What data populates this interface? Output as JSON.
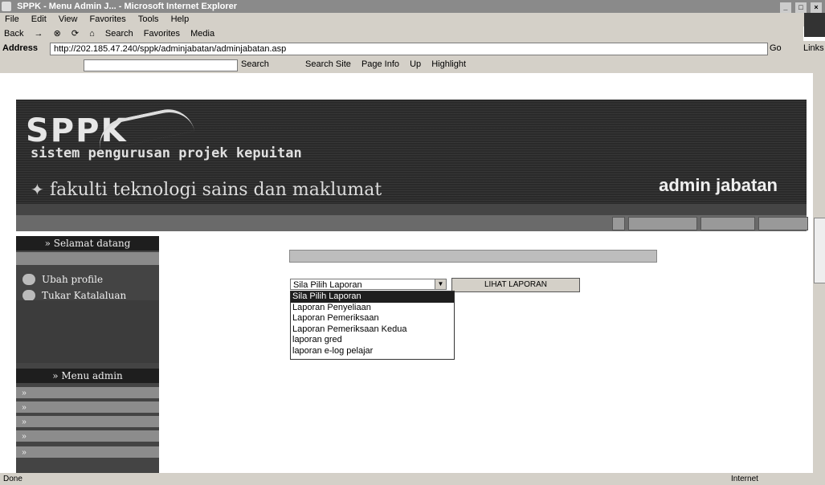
{
  "window": {
    "title": "SPPK - Menu Admin J... - Microsoft Internet Explorer"
  },
  "menubar": {
    "items": [
      "File",
      "Edit",
      "View",
      "Favorites",
      "Tools",
      "Help"
    ]
  },
  "toolbar": {
    "items": [
      "Back",
      "Search",
      "Favorites",
      "Media"
    ]
  },
  "address": {
    "label": "Address",
    "url": "http://202.185.47.240/sppk/adminjabatan/adminjabatan.asp",
    "go": "Go",
    "links": "Links"
  },
  "googlebar": {
    "search_label": "Search",
    "items": [
      "Search Site",
      "Page Info",
      "Up",
      "Highlight"
    ]
  },
  "banner": {
    "logo": "SPPK",
    "subtitle": "sistem pengurusan projek kepuitan",
    "faculty": "fakulti teknologi sains dan maklumat",
    "role": "admin jabatan"
  },
  "subbar": {
    "buttons": [
      "",
      "",
      ""
    ]
  },
  "sidebar": {
    "welcome": "Selamat datang",
    "user": "",
    "links": [
      {
        "label": "Ubah profile"
      },
      {
        "label": "Tukar Katalaluan"
      }
    ],
    "menu_title": "Menu admin",
    "menu_items": [
      "",
      "",
      "",
      "",
      ""
    ]
  },
  "content": {
    "title": "",
    "select_value": "Sila Pilih Laporan",
    "button": "LIHAT LAPORAN",
    "options": [
      "Sila Pilih Laporan",
      "Laporan Penyeliaan",
      "Laporan Pemeriksaan",
      "Laporan Pemeriksaan Kedua",
      "laporan gred",
      "laporan e-log pelajar"
    ],
    "selected_index": 0
  },
  "status": {
    "left": "Done",
    "right": "Internet"
  }
}
